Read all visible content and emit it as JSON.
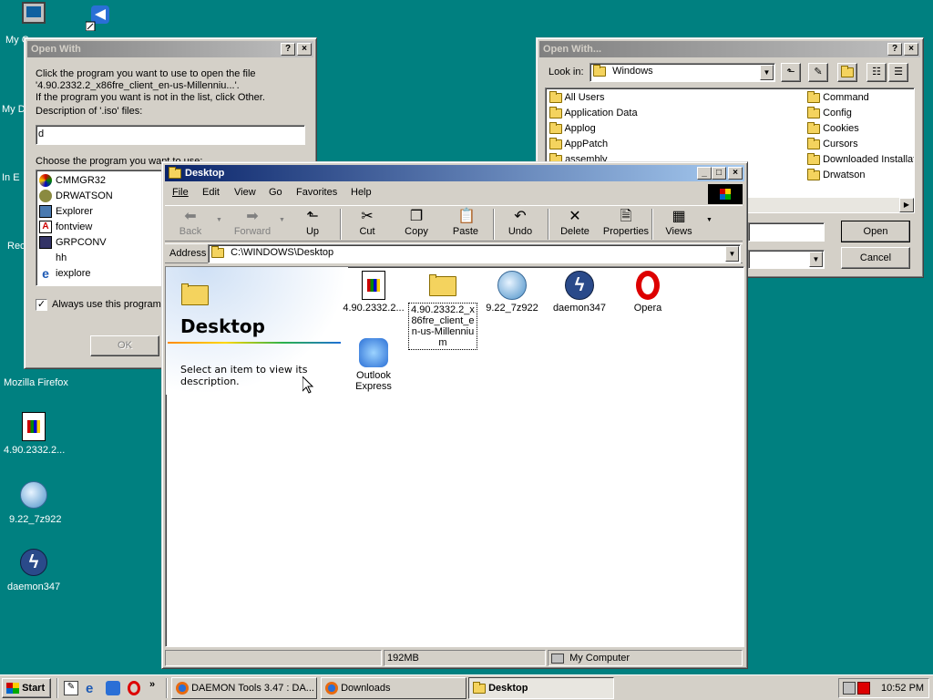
{
  "desktop": {
    "icons": [
      {
        "label": "My C"
      },
      {
        "label": "My D"
      },
      {
        "label": "In E"
      },
      {
        "label": "Rec"
      },
      {
        "label": "Mozilla Firefox"
      },
      {
        "label": "4.90.2332.2..."
      },
      {
        "label": "9.22_7z922"
      },
      {
        "label": "daemon347"
      }
    ]
  },
  "openwith_left": {
    "title": "Open With",
    "help_btn": "?",
    "close_btn": "×",
    "instruction_line1": "Click the program you want to use to open the file",
    "instruction_line2": "'4.90.2332.2_x86fre_client_en-us-Millenniu...'.",
    "instruction_line3": "If the program you want is not in the list, click Other.",
    "description_label": "Description of '.iso' files:",
    "description_value": "d",
    "choose_label": "Choose the program you want to use:",
    "programs": [
      "CMMGR32",
      "DRWATSON",
      "Explorer",
      "fontview",
      "GRPCONV",
      "hh",
      "iexplore"
    ],
    "always_use_label": "Always use this program t",
    "ok_button": "OK"
  },
  "openwith_right": {
    "title": "Open With...",
    "help_btn": "?",
    "close_btn": "×",
    "look_in_label": "Look in:",
    "look_in_value": "Windows",
    "folders_col1": [
      "All Users",
      "Application Data",
      "Applog",
      "AppPatch",
      "assembly"
    ],
    "folders_col2": [
      "Command",
      "Config",
      "Cookies",
      "Cursors",
      "Downloaded Installat",
      "Drwatson"
    ],
    "open_button": "Open",
    "cancel_button": "Cancel"
  },
  "explorer": {
    "title": "Desktop",
    "minimize": "_",
    "maximize": "□",
    "close": "×",
    "menu": [
      "File",
      "Edit",
      "View",
      "Go",
      "Favorites",
      "Help"
    ],
    "toolbar": {
      "back": "Back",
      "forward": "Forward",
      "up": "Up",
      "cut": "Cut",
      "copy": "Copy",
      "paste": "Paste",
      "undo": "Undo",
      "delete": "Delete",
      "properties": "Properties",
      "views": "Views"
    },
    "address_label": "Address",
    "address_value": "C:\\WINDOWS\\Desktop",
    "panel_title": "Desktop",
    "panel_desc": "Select an item to view its description.",
    "items": [
      {
        "label": "4.90.2332.2..."
      },
      {
        "label": "4.90.2332.2_x86fre_client_en-us-Millennium"
      },
      {
        "label": "9.22_7z922"
      },
      {
        "label": "daemon347"
      },
      {
        "label": "Opera"
      },
      {
        "label": "Outlook Express"
      }
    ],
    "status_size": "192MB",
    "status_zone": "My Computer"
  },
  "taskbar": {
    "start": "Start",
    "tasks": [
      {
        "label": "DAEMON Tools 3.47 : DA..."
      },
      {
        "label": "Downloads"
      },
      {
        "label": "Desktop"
      }
    ],
    "clock": "10:52 PM",
    "more": "»"
  },
  "colors": {
    "desktop": "#008080",
    "title_active": "#0a246a",
    "title_inactive": "#808080",
    "face": "#d4d0c8"
  }
}
